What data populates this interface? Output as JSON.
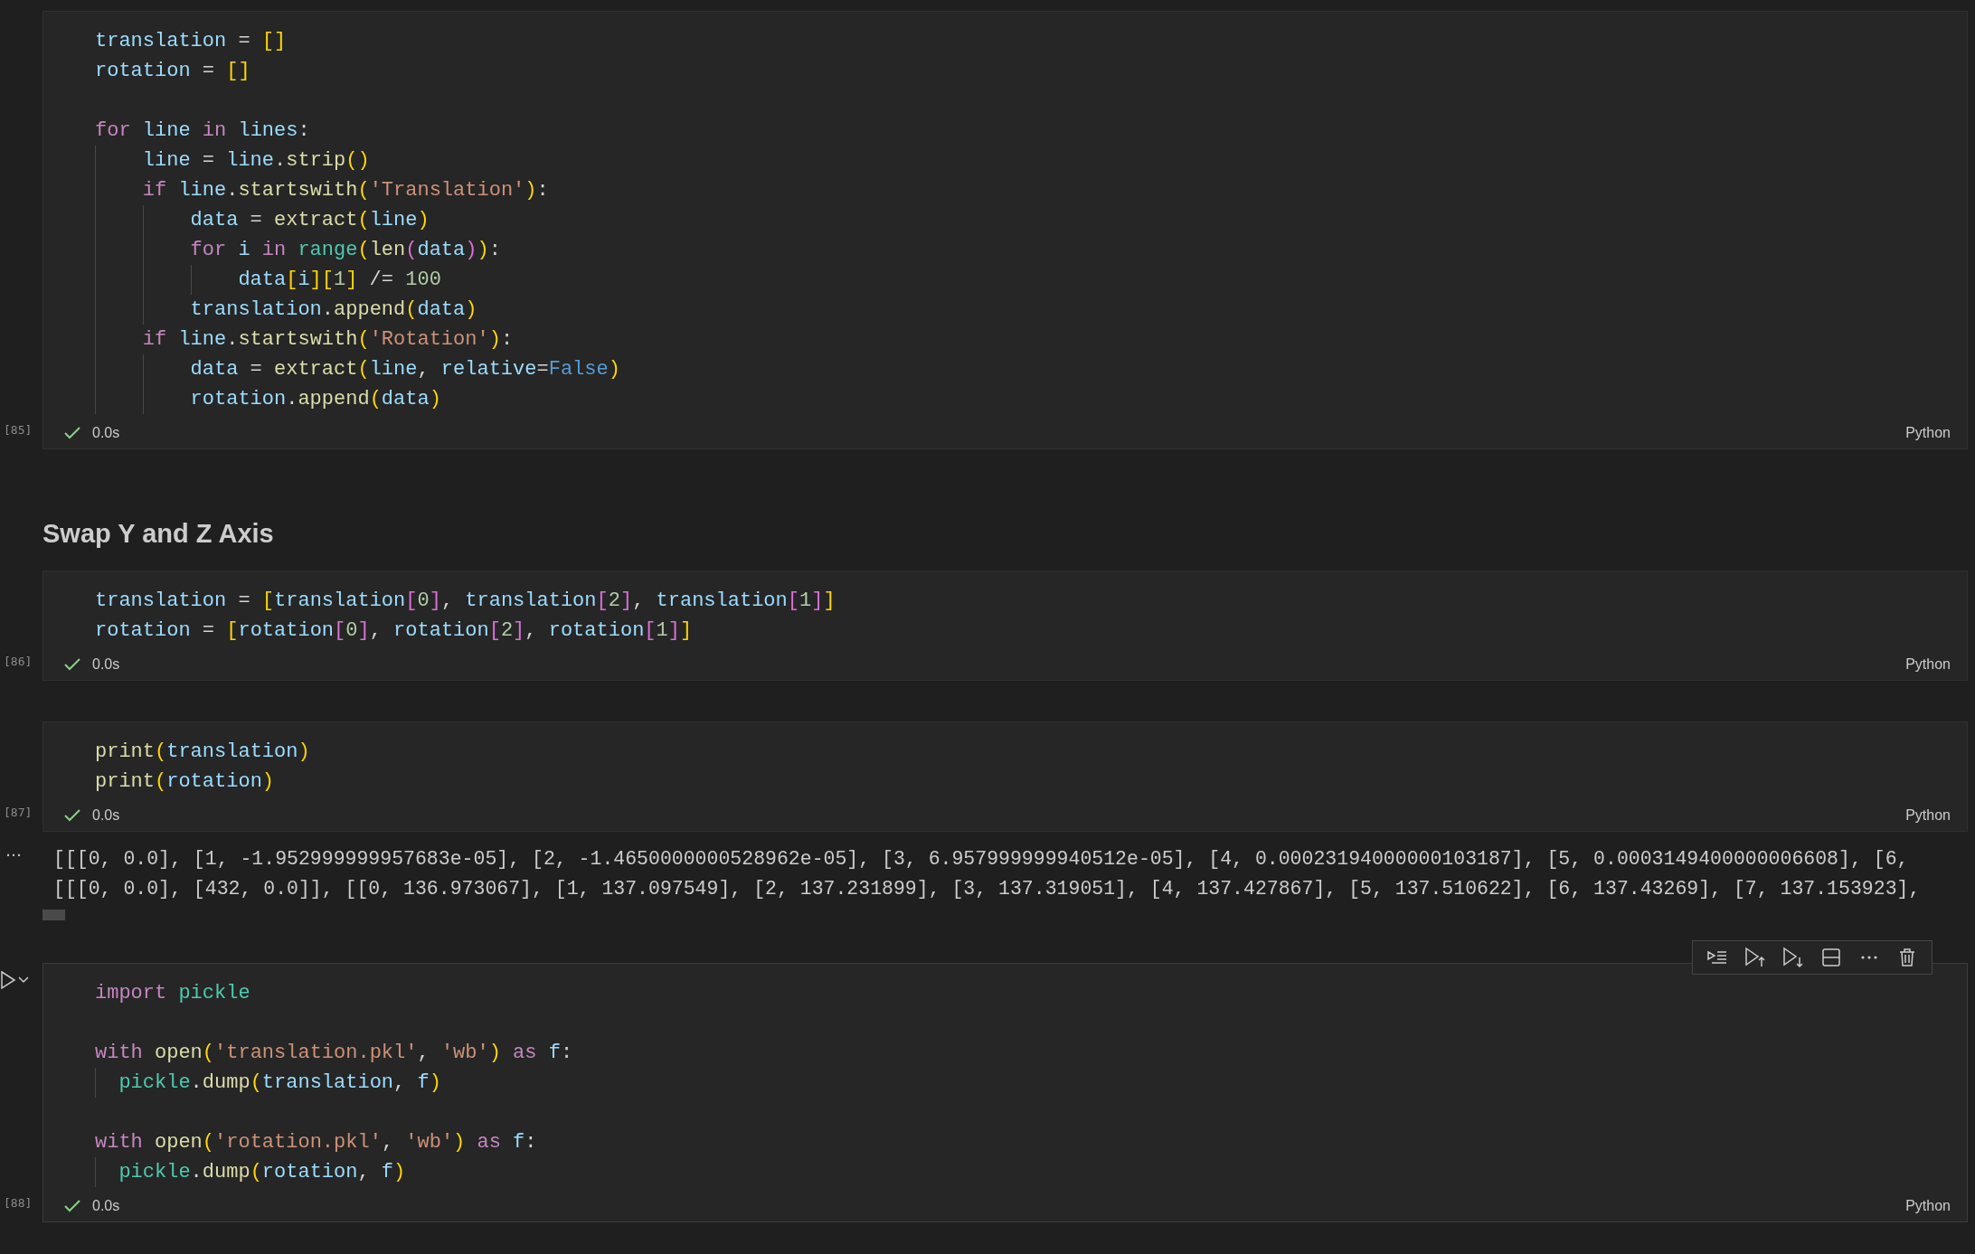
{
  "cells": [
    {
      "kind": "code",
      "count": "[85]",
      "succeeded": true,
      "duration": "0.0s",
      "language": "Python",
      "lines": [
        {
          "tokens": [
            {
              "kind": "var",
              "text": "translation"
            },
            {
              "kind": "op",
              "text": " = "
            },
            {
              "kind": "b1",
              "text": "[]"
            }
          ]
        },
        {
          "tokens": [
            {
              "kind": "var",
              "text": "rotation"
            },
            {
              "kind": "op",
              "text": " = "
            },
            {
              "kind": "b1",
              "text": "[]"
            }
          ]
        },
        {
          "kind": "blank"
        },
        {
          "tokens": [
            {
              "kind": "kw",
              "text": "for"
            },
            {
              "kind": "var",
              "text": " line "
            },
            {
              "kind": "kw",
              "text": "in"
            },
            {
              "kind": "var",
              "text": " lines"
            },
            {
              "kind": "op",
              "text": ":"
            }
          ],
          "children": [
            {
              "tokens": [
                {
                  "kind": "var",
                  "text": "line"
                },
                {
                  "kind": "op",
                  "text": " = "
                },
                {
                  "kind": "var",
                  "text": "line"
                },
                {
                  "kind": "op",
                  "text": "."
                },
                {
                  "kind": "fn",
                  "text": "strip"
                },
                {
                  "kind": "b1",
                  "text": "()"
                }
              ]
            },
            {
              "tokens": [
                {
                  "kind": "kw",
                  "text": "if"
                },
                {
                  "kind": "var",
                  "text": " line"
                },
                {
                  "kind": "op",
                  "text": "."
                },
                {
                  "kind": "fn",
                  "text": "startswith"
                },
                {
                  "kind": "b1",
                  "text": "("
                },
                {
                  "kind": "str",
                  "text": "'Translation'"
                },
                {
                  "kind": "b1",
                  "text": ")"
                },
                {
                  "kind": "op",
                  "text": ":"
                }
              ],
              "children": [
                {
                  "tokens": [
                    {
                      "kind": "var",
                      "text": "data"
                    },
                    {
                      "kind": "op",
                      "text": " = "
                    },
                    {
                      "kind": "fn",
                      "text": "extract"
                    },
                    {
                      "kind": "b1",
                      "text": "("
                    },
                    {
                      "kind": "var",
                      "text": "line"
                    },
                    {
                      "kind": "b1",
                      "text": ")"
                    }
                  ]
                },
                {
                  "tokens": [
                    {
                      "kind": "kw",
                      "text": "for"
                    },
                    {
                      "kind": "var",
                      "text": " i "
                    },
                    {
                      "kind": "kw",
                      "text": "in "
                    },
                    {
                      "kind": "cls",
                      "text": "range"
                    },
                    {
                      "kind": "b1",
                      "text": "("
                    },
                    {
                      "kind": "fn",
                      "text": "len"
                    },
                    {
                      "kind": "b2",
                      "text": "("
                    },
                    {
                      "kind": "var",
                      "text": "data"
                    },
                    {
                      "kind": "b2",
                      "text": ")"
                    },
                    {
                      "kind": "b1",
                      "text": ")"
                    },
                    {
                      "kind": "op",
                      "text": ":"
                    }
                  ],
                  "children": [
                    {
                      "tokens": [
                        {
                          "kind": "var",
                          "text": "data"
                        },
                        {
                          "kind": "b1",
                          "text": "["
                        },
                        {
                          "kind": "var",
                          "text": "i"
                        },
                        {
                          "kind": "b1",
                          "text": "]["
                        },
                        {
                          "kind": "num",
                          "text": "1"
                        },
                        {
                          "kind": "b1",
                          "text": "]"
                        },
                        {
                          "kind": "op",
                          "text": " /= "
                        },
                        {
                          "kind": "num",
                          "text": "100"
                        }
                      ]
                    }
                  ]
                },
                {
                  "tokens": [
                    {
                      "kind": "var",
                      "text": "translation"
                    },
                    {
                      "kind": "op",
                      "text": "."
                    },
                    {
                      "kind": "fn",
                      "text": "append"
                    },
                    {
                      "kind": "b1",
                      "text": "("
                    },
                    {
                      "kind": "var",
                      "text": "data"
                    },
                    {
                      "kind": "b1",
                      "text": ")"
                    }
                  ]
                }
              ]
            },
            {
              "tokens": [
                {
                  "kind": "kw",
                  "text": "if"
                },
                {
                  "kind": "var",
                  "text": " line"
                },
                {
                  "kind": "op",
                  "text": "."
                },
                {
                  "kind": "fn",
                  "text": "startswith"
                },
                {
                  "kind": "b1",
                  "text": "("
                },
                {
                  "kind": "str",
                  "text": "'Rotation'"
                },
                {
                  "kind": "b1",
                  "text": ")"
                },
                {
                  "kind": "op",
                  "text": ":"
                }
              ],
              "children": [
                {
                  "tokens": [
                    {
                      "kind": "var",
                      "text": "data"
                    },
                    {
                      "kind": "op",
                      "text": " = "
                    },
                    {
                      "kind": "fn",
                      "text": "extract"
                    },
                    {
                      "kind": "b1",
                      "text": "("
                    },
                    {
                      "kind": "var",
                      "text": "line"
                    },
                    {
                      "kind": "op",
                      "text": ", "
                    },
                    {
                      "kind": "var",
                      "text": "relative"
                    },
                    {
                      "kind": "op",
                      "text": "="
                    },
                    {
                      "kind": "const",
                      "text": "False"
                    },
                    {
                      "kind": "b1",
                      "text": ")"
                    }
                  ]
                },
                {
                  "tokens": [
                    {
                      "kind": "var",
                      "text": "rotation"
                    },
                    {
                      "kind": "op",
                      "text": "."
                    },
                    {
                      "kind": "fn",
                      "text": "append"
                    },
                    {
                      "kind": "b1",
                      "text": "("
                    },
                    {
                      "kind": "var",
                      "text": "data"
                    },
                    {
                      "kind": "b1",
                      "text": ")"
                    }
                  ]
                }
              ]
            }
          ]
        }
      ]
    },
    {
      "kind": "markdown",
      "heading": "Swap Y and Z Axis"
    },
    {
      "kind": "code",
      "count": "[86]",
      "succeeded": true,
      "duration": "0.0s",
      "language": "Python",
      "lines": [
        {
          "tokens": [
            {
              "kind": "var",
              "text": "translation"
            },
            {
              "kind": "op",
              "text": " = "
            },
            {
              "kind": "b1",
              "text": "["
            },
            {
              "kind": "var",
              "text": "translation"
            },
            {
              "kind": "b2",
              "text": "["
            },
            {
              "kind": "num",
              "text": "0"
            },
            {
              "kind": "b2",
              "text": "]"
            },
            {
              "kind": "op",
              "text": ", "
            },
            {
              "kind": "var",
              "text": "translation"
            },
            {
              "kind": "b2",
              "text": "["
            },
            {
              "kind": "num",
              "text": "2"
            },
            {
              "kind": "b2",
              "text": "]"
            },
            {
              "kind": "op",
              "text": ", "
            },
            {
              "kind": "var",
              "text": "translation"
            },
            {
              "kind": "b2",
              "text": "["
            },
            {
              "kind": "num",
              "text": "1"
            },
            {
              "kind": "b2",
              "text": "]"
            },
            {
              "kind": "b1",
              "text": "]"
            }
          ]
        },
        {
          "tokens": [
            {
              "kind": "var",
              "text": "rotation"
            },
            {
              "kind": "op",
              "text": " = "
            },
            {
              "kind": "b1",
              "text": "["
            },
            {
              "kind": "var",
              "text": "rotation"
            },
            {
              "kind": "b2",
              "text": "["
            },
            {
              "kind": "num",
              "text": "0"
            },
            {
              "kind": "b2",
              "text": "]"
            },
            {
              "kind": "op",
              "text": ", "
            },
            {
              "kind": "var",
              "text": "rotation"
            },
            {
              "kind": "b2",
              "text": "["
            },
            {
              "kind": "num",
              "text": "2"
            },
            {
              "kind": "b2",
              "text": "]"
            },
            {
              "kind": "op",
              "text": ", "
            },
            {
              "kind": "var",
              "text": "rotation"
            },
            {
              "kind": "b2",
              "text": "["
            },
            {
              "kind": "num",
              "text": "1"
            },
            {
              "kind": "b2",
              "text": "]"
            },
            {
              "kind": "b1",
              "text": "]"
            }
          ]
        }
      ]
    },
    {
      "kind": "code",
      "count": "[87]",
      "succeeded": true,
      "duration": "0.0s",
      "language": "Python",
      "lines": [
        {
          "tokens": [
            {
              "kind": "fn",
              "text": "print"
            },
            {
              "kind": "b1",
              "text": "("
            },
            {
              "kind": "var",
              "text": "translation"
            },
            {
              "kind": "b1",
              "text": ")"
            }
          ]
        },
        {
          "tokens": [
            {
              "kind": "fn",
              "text": "print"
            },
            {
              "kind": "b1",
              "text": "("
            },
            {
              "kind": "var",
              "text": "rotation"
            },
            {
              "kind": "b1",
              "text": ")"
            }
          ]
        }
      ],
      "output": {
        "marker": "…",
        "lines": [
          "[[[0, 0.0], [1, -1.952999999957683e-05], [2, -1.4650000000528962e-05], [3, 6.957999999940512e-05], [4, 0.00023194000000103187], [5, 0.0003149400000006608], [6,",
          "[[[0, 0.0], [432, 0.0]], [[0, 136.973067], [1, 137.097549], [2, 137.231899], [3, 137.319051], [4, 137.427867], [5, 137.510622], [6, 137.43269], [7, 137.153923],"
        ]
      }
    },
    {
      "kind": "code",
      "count": "[88]",
      "narrow_indent": true,
      "hovered": true,
      "succeeded": true,
      "duration": "0.0s",
      "language": "Python",
      "lines": [
        {
          "tokens": [
            {
              "kind": "kw",
              "text": "import "
            },
            {
              "kind": "cls",
              "text": "pickle"
            }
          ]
        },
        {
          "kind": "blank"
        },
        {
          "tokens": [
            {
              "kind": "kw",
              "text": "with "
            },
            {
              "kind": "fn",
              "text": "open"
            },
            {
              "kind": "b1",
              "text": "("
            },
            {
              "kind": "str",
              "text": "'translation.pkl'"
            },
            {
              "kind": "op",
              "text": ", "
            },
            {
              "kind": "str",
              "text": "'wb'"
            },
            {
              "kind": "b1",
              "text": ") "
            },
            {
              "kind": "kw",
              "text": "as"
            },
            {
              "kind": "var",
              "text": " f"
            },
            {
              "kind": "op",
              "text": ":"
            }
          ],
          "children": [
            {
              "tokens": [
                {
                  "kind": "cls",
                  "text": "pickle"
                },
                {
                  "kind": "op",
                  "text": "."
                },
                {
                  "kind": "fn",
                  "text": "dump"
                },
                {
                  "kind": "b1",
                  "text": "("
                },
                {
                  "kind": "var",
                  "text": "translation"
                },
                {
                  "kind": "op",
                  "text": ", "
                },
                {
                  "kind": "var",
                  "text": "f"
                },
                {
                  "kind": "b1",
                  "text": ")"
                }
              ]
            }
          ]
        },
        {
          "kind": "blank"
        },
        {
          "tokens": [
            {
              "kind": "kw",
              "text": "with "
            },
            {
              "kind": "fn",
              "text": "open"
            },
            {
              "kind": "b1",
              "text": "("
            },
            {
              "kind": "str",
              "text": "'rotation.pkl'"
            },
            {
              "kind": "op",
              "text": ", "
            },
            {
              "kind": "str",
              "text": "'wb'"
            },
            {
              "kind": "b1",
              "text": ") "
            },
            {
              "kind": "kw",
              "text": "as"
            },
            {
              "kind": "var",
              "text": " f"
            },
            {
              "kind": "op",
              "text": ":"
            }
          ],
          "children": [
            {
              "tokens": [
                {
                  "kind": "cls",
                  "text": "pickle"
                },
                {
                  "kind": "op",
                  "text": "."
                },
                {
                  "kind": "fn",
                  "text": "dump"
                },
                {
                  "kind": "b1",
                  "text": "("
                },
                {
                  "kind": "var",
                  "text": "rotation"
                },
                {
                  "kind": "op",
                  "text": ", "
                },
                {
                  "kind": "var",
                  "text": "f"
                },
                {
                  "kind": "b1",
                  "text": ")"
                }
              ]
            }
          ]
        }
      ]
    }
  ]
}
